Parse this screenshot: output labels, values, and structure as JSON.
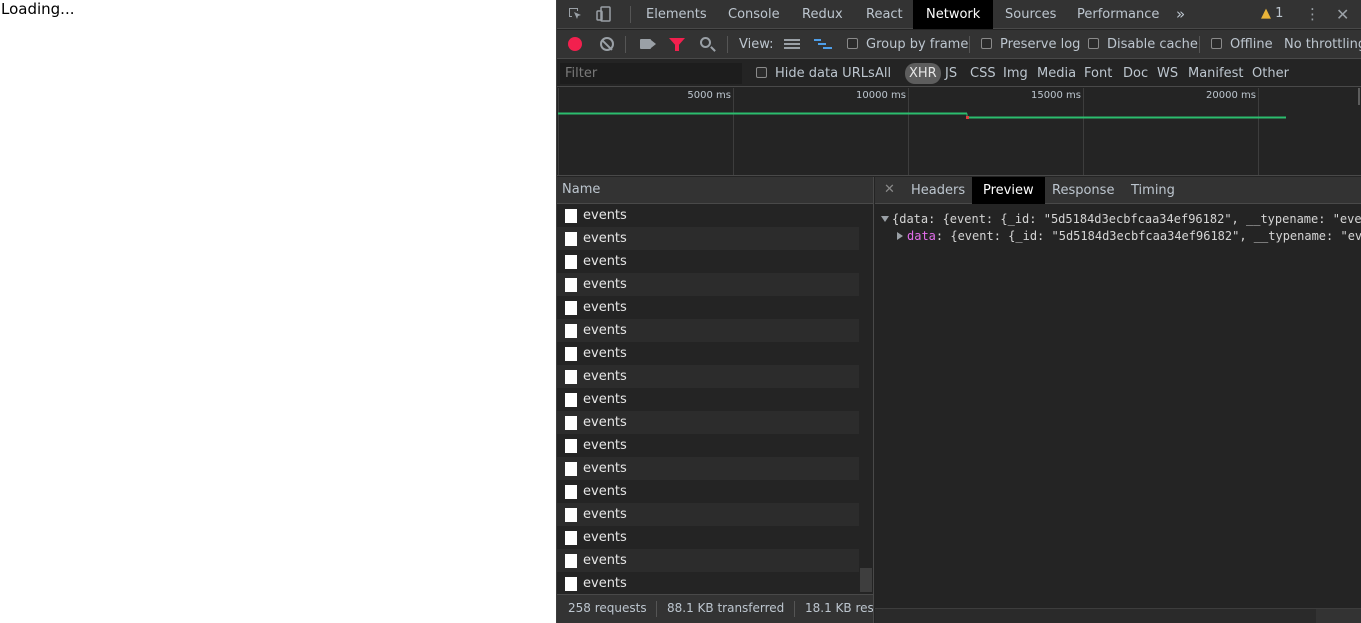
{
  "page": {
    "loading_text": "Loading..."
  },
  "devtools": {
    "tabs": [
      {
        "label": "Elements"
      },
      {
        "label": "Console"
      },
      {
        "label": "Redux"
      },
      {
        "label": "React"
      },
      {
        "label": "Network"
      },
      {
        "label": "Sources"
      },
      {
        "label": "Performance"
      }
    ],
    "more_tabs_icon": "chevron-double-right-icon",
    "warning_count": "1",
    "toolbar": {
      "view_label": "View:",
      "group_by_frame": "Group by frame",
      "preserve_log": "Preserve log",
      "disable_cache": "Disable cache",
      "offline": "Offline",
      "throttling": "No throttling"
    },
    "filter": {
      "placeholder": "Filter",
      "hide_data_urls": "Hide data URLs",
      "types": [
        "All",
        "XHR",
        "JS",
        "CSS",
        "Img",
        "Media",
        "Font",
        "Doc",
        "WS",
        "Manifest",
        "Other"
      ],
      "active_type": "XHR"
    },
    "overview": {
      "ticks": [
        "5000 ms",
        "10000 ms",
        "15000 ms",
        "20000 ms"
      ]
    },
    "requests": {
      "column_name": "Name",
      "rows": [
        "events",
        "events",
        "events",
        "events",
        "events",
        "events",
        "events",
        "events",
        "events",
        "events",
        "events",
        "events",
        "events",
        "events",
        "events",
        "events",
        "events"
      ]
    },
    "status": {
      "requests": "258 requests",
      "transferred": "88.1 KB transferred",
      "resources": "18.1 KB res"
    },
    "detail": {
      "tabs": [
        "Headers",
        "Preview",
        "Response",
        "Timing"
      ],
      "active_tab": "Preview",
      "preview_line1": "{data: {event: {_id: \"5d5184d3ecbfcaa34ef96182\", __typename: \"eve",
      "preview_key": "data",
      "preview_line2": ": {event: {_id: \"5d5184d3ecbfcaa34ef96182\", __typename: \"ev"
    }
  }
}
